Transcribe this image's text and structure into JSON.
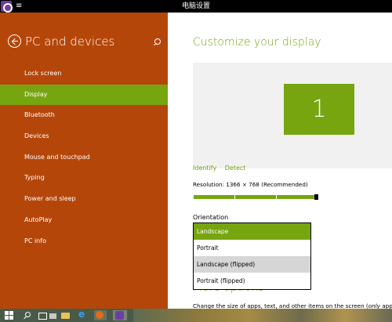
{
  "window": {
    "title": "电脑设置",
    "menu_glyph": "≡"
  },
  "sidebar": {
    "title": "PC and devices",
    "items": [
      {
        "label": "Lock screen"
      },
      {
        "label": "Display",
        "active": true
      },
      {
        "label": "Bluetooth"
      },
      {
        "label": "Devices"
      },
      {
        "label": "Mouse and touchpad"
      },
      {
        "label": "Typing"
      },
      {
        "label": "Power and sleep"
      },
      {
        "label": "AutoPlay"
      },
      {
        "label": "PC info"
      }
    ]
  },
  "main": {
    "title": "Customize your display",
    "monitor_number": "1",
    "identify_label": "Identify",
    "detect_label": "Detect",
    "resolution_text": "Resolution: 1366 × 768 (Recommended)",
    "resolution_slider_value": 1.0,
    "orientation_label": "Orientation",
    "orientation_options": [
      "Landscape",
      "Portrait",
      "Landscape (flipped)",
      "Portrait (flipped)"
    ],
    "orientation_selected": "Landscape",
    "more_options_partial": "More options",
    "change_size_text": "Change the size of apps, text, and other items on the screen (",
    "change_size_italic": "only",
    "change_size_tail": " applies to"
  },
  "colors": {
    "accent": "#76a50f",
    "sidebar": "#b5460a",
    "titlebar": "#000000"
  },
  "taskbar": {
    "icons": [
      "start-icon",
      "search-icon",
      "task-view-icon",
      "store-icon",
      "file-explorer-icon",
      "internet-explorer-icon",
      "firefox-icon",
      "settings-app-icon"
    ]
  }
}
